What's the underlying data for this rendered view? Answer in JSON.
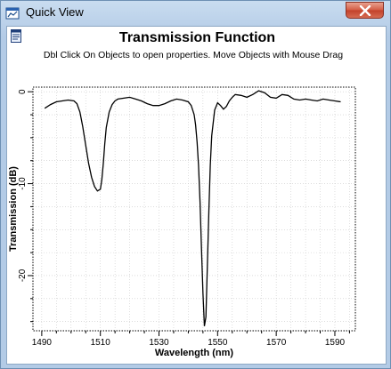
{
  "window": {
    "title": "Quick View",
    "icons": {
      "app": "app-window-icon",
      "close": "close-icon",
      "document": "document-icon"
    }
  },
  "header": {
    "hint": "Dbl Click On Objects to open properties.  Move Objects with Mouse Drag"
  },
  "chart_data": {
    "type": "line",
    "title": "Transmission Function",
    "xlabel": "Wavelength (nm)",
    "ylabel": "Transmission (dB)",
    "xlim": [
      1487,
      1597
    ],
    "ylim": [
      -26,
      0.5
    ],
    "x_ticks": [
      1490,
      1510,
      1530,
      1550,
      1570,
      1590
    ],
    "y_ticks": [
      0,
      -10,
      -20
    ],
    "grid": true,
    "series": [
      {
        "color": "#000000",
        "x": [
          1491,
          1493,
          1495,
          1497,
          1499,
          1501,
          1502,
          1503,
          1504,
          1505,
          1506,
          1507,
          1508,
          1509,
          1510,
          1510.5,
          1511,
          1511.5,
          1512,
          1513,
          1514,
          1515,
          1516,
          1518,
          1520,
          1522,
          1524,
          1526,
          1528,
          1530,
          1532,
          1534,
          1536,
          1538,
          1540,
          1541,
          1542,
          1542.5,
          1543,
          1543.5,
          1544,
          1544.5,
          1545,
          1545.5,
          1546,
          1546.5,
          1547,
          1547.5,
          1548,
          1549,
          1550,
          1551,
          1552,
          1553,
          1554,
          1555,
          1556,
          1558,
          1560,
          1562,
          1564,
          1566,
          1568,
          1570,
          1572,
          1574,
          1576,
          1578,
          1580,
          1582,
          1584,
          1586,
          1588,
          1590,
          1592
        ],
        "y": [
          -1.8,
          -1.4,
          -1.1,
          -1.0,
          -0.9,
          -1.0,
          -1.3,
          -2.2,
          -3.8,
          -5.8,
          -7.8,
          -9.3,
          -10.3,
          -10.8,
          -10.6,
          -9.6,
          -7.8,
          -5.7,
          -3.9,
          -2.2,
          -1.4,
          -1.0,
          -0.8,
          -0.7,
          -0.6,
          -0.8,
          -1.0,
          -1.3,
          -1.5,
          -1.5,
          -1.3,
          -1.0,
          -0.8,
          -0.9,
          -1.1,
          -1.5,
          -2.5,
          -3.6,
          -5.5,
          -8.0,
          -12.0,
          -17.0,
          -22.0,
          -25.5,
          -24.5,
          -19.0,
          -13.0,
          -8.0,
          -4.8,
          -2.0,
          -1.2,
          -1.5,
          -1.9,
          -1.6,
          -1.0,
          -0.6,
          -0.3,
          -0.4,
          -0.6,
          -0.3,
          0.1,
          -0.1,
          -0.6,
          -0.7,
          -0.3,
          -0.4,
          -0.8,
          -0.9,
          -0.8,
          -0.9,
          -1.0,
          -0.8,
          -0.9,
          -1.0,
          -1.1
        ]
      }
    ]
  }
}
